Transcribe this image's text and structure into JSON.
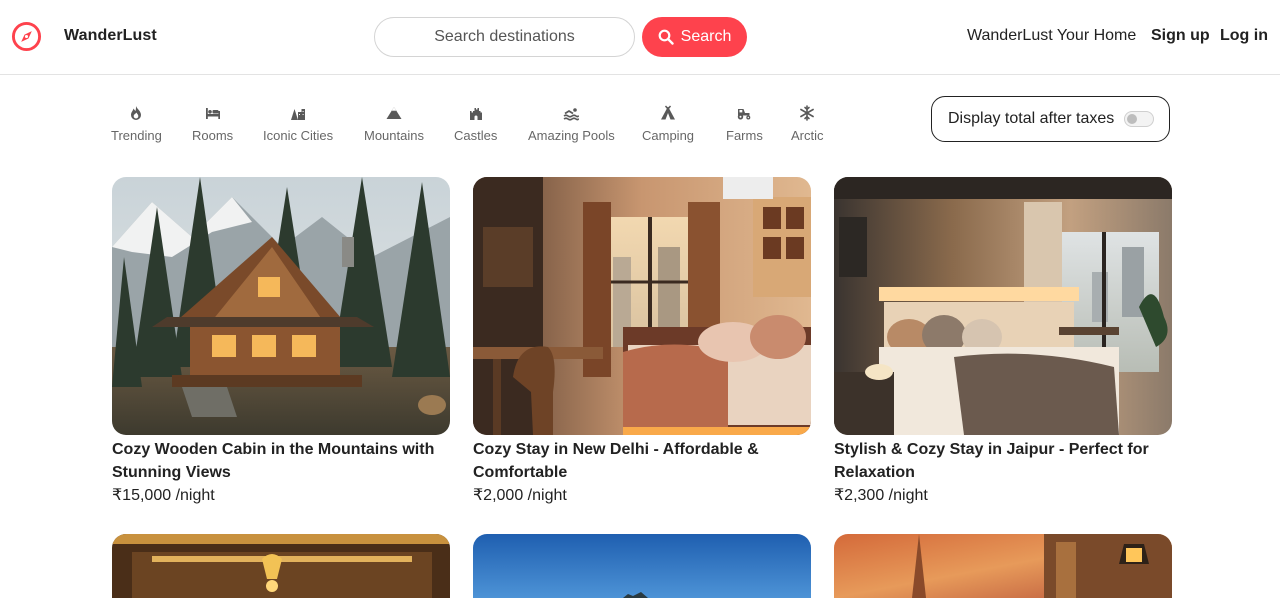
{
  "brand": {
    "name": "WanderLust",
    "icon": "compass-icon",
    "accent": "#fe424d"
  },
  "search": {
    "placeholder": "Search destinations",
    "value": "",
    "button_label": "Search",
    "button_icon": "search-icon"
  },
  "nav": {
    "home": "WanderLust Your Home",
    "signup": "Sign up",
    "login": "Log in"
  },
  "filters": [
    {
      "label": "Trending",
      "icon": "fire-icon"
    },
    {
      "label": "Rooms",
      "icon": "bed-icon"
    },
    {
      "label": "Iconic Cities",
      "icon": "city-icon"
    },
    {
      "label": "Mountains",
      "icon": "mountain-icon"
    },
    {
      "label": "Castles",
      "icon": "castle-icon"
    },
    {
      "label": "Amazing Pools",
      "icon": "swimmer-icon"
    },
    {
      "label": "Camping",
      "icon": "tent-icon"
    },
    {
      "label": "Farms",
      "icon": "tractor-icon"
    },
    {
      "label": "Arctic",
      "icon": "snowflake-icon"
    }
  ],
  "tax_toggle": {
    "label": "Display total after taxes",
    "enabled": false
  },
  "listings": [
    {
      "title": "Cozy Wooden Cabin in the Mountains with Stunning Views",
      "price": "₹15,000 /night"
    },
    {
      "title": "Cozy Stay in New Delhi - Affordable & Comfortable",
      "price": "₹2,000 /night"
    },
    {
      "title": "Stylish & Cozy Stay in Jaipur - Perfect for Relaxation",
      "price": "₹2,300 /night"
    }
  ]
}
